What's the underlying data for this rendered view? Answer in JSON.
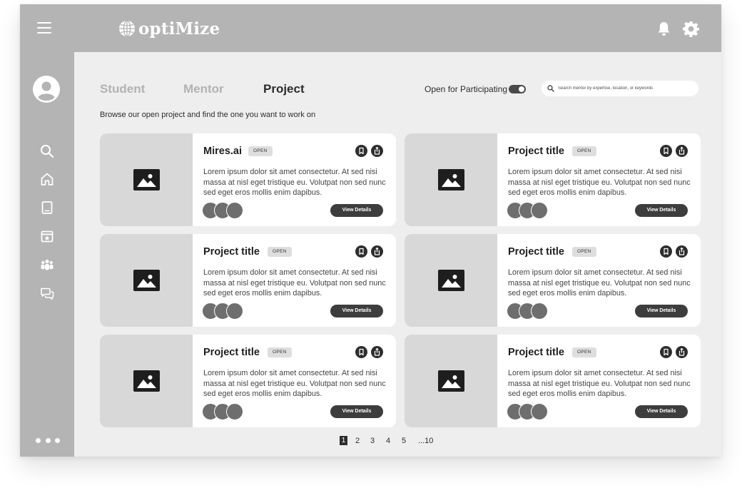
{
  "brand": {
    "name": "optiMize"
  },
  "tabs": [
    {
      "label": "Student",
      "active": false
    },
    {
      "label": "Mentor",
      "active": false
    },
    {
      "label": "Project",
      "active": true
    }
  ],
  "filter": {
    "toggle_label": "Open for Participating",
    "toggle_on": true
  },
  "search": {
    "placeholder": "Search mentor by expertise, location, or keywords",
    "value": ""
  },
  "intro": "Browse our open project and find the one you want to work on",
  "sidebar": {
    "items": [
      "user-avatar-icon",
      "search-icon",
      "home-icon",
      "book-icon",
      "calendar-star-icon",
      "group-icon",
      "chat-icon"
    ],
    "more": "more-dots-icon"
  },
  "cards": [
    {
      "title": "Mires.ai",
      "status": "OPEN",
      "description": "Lorem ipsum dolor sit amet consectetur. At sed nisi massa at nisl eget tristique eu. Volutpat non sed nunc sed eget eros mollis enim dapibus.",
      "button": "View Details"
    },
    {
      "title": "Project title",
      "status": "OPEN",
      "description": "Lorem ipsum dolor sit amet consectetur. At sed nisi massa at nisl eget tristique eu. Volutpat non sed nunc sed eget eros mollis enim dapibus.",
      "button": "View Details"
    },
    {
      "title": "Project title",
      "status": "OPEN",
      "description": "Lorem ipsum dolor sit amet consectetur. At sed nisi massa at nisl eget tristique eu. Volutpat non sed nunc sed eget eros mollis enim dapibus.",
      "button": "View Details"
    },
    {
      "title": "Project title",
      "status": "OPEN",
      "description": "Lorem ipsum dolor sit amet consectetur. At sed nisi massa at nisl eget tristique eu. Volutpat non sed nunc sed eget eros mollis enim dapibus.",
      "button": "View Details"
    },
    {
      "title": "Project title",
      "status": "OPEN",
      "description": "Lorem ipsum dolor sit amet consectetur. At sed nisi massa at nisl eget tristique eu. Volutpat non sed nunc sed eget eros mollis enim dapibus.",
      "button": "View Details"
    },
    {
      "title": "Project title",
      "status": "OPEN",
      "description": "Lorem ipsum dolor sit amet consectetur. At sed nisi massa at nisl eget tristique eu. Volutpat non sed nunc sed eget eros mollis enim dapibus.",
      "button": "View Details"
    }
  ],
  "pagination": {
    "pages": [
      "1",
      "2",
      "3",
      "4",
      "5",
      "...10"
    ],
    "current": "1"
  },
  "colors": {
    "topbar": "#b4b4b4",
    "background": "#eeeeee",
    "card": "#ffffff",
    "accent": "#3d3d3d",
    "placeholder": "#d8d8d8"
  }
}
